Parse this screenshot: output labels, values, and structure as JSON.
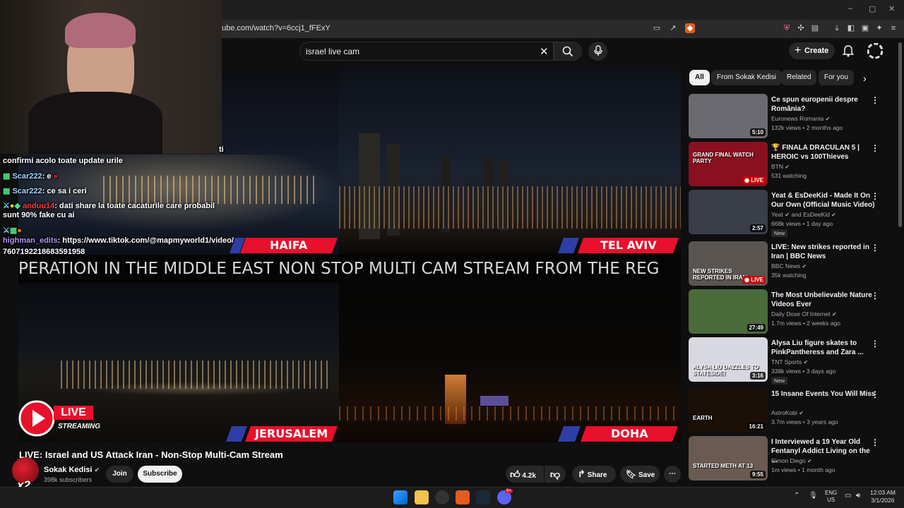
{
  "browser": {
    "url": "ube.com/watch?v=6ccj1_fFExY",
    "window_controls": [
      "–",
      "▢",
      "✕"
    ]
  },
  "search": {
    "query": "israel live cam"
  },
  "header": {
    "create_label": "Create"
  },
  "stream_overlay": {
    "ticker": "PERATION IN THE MIDDLE EAST NON STOP MULTI CAM STREAM FROM THE REG",
    "cameras": [
      "HAIFA",
      "TEL AVIV",
      "JERUSALEM",
      "DOHA"
    ],
    "live_label": "LIVE",
    "streaming_label": "STREAMING"
  },
  "chat": {
    "lines": [
      {
        "user": "",
        "text": "ti",
        "color": "#ffffff"
      },
      {
        "user": "",
        "text": "confirmi acolo toate update urile",
        "color": "#ffffff"
      },
      {
        "user": "Scar222",
        "text": ": e",
        "color": "#9fd4ff"
      },
      {
        "user": "Scar222",
        "text": ": ce sa i ceri",
        "color": "#9fd4ff"
      },
      {
        "user": "anduu14",
        "text": ": dati share la toate cacaturile care probabil",
        "color": "#ff3b3b"
      },
      {
        "user": "",
        "text": "sunt 90% fake cu ai",
        "color": "#ffffff"
      },
      {
        "user": "highman_edits",
        "text": ": https://www.tiktok.com/@mapmyworld1/video/",
        "color": "#b392f0"
      },
      {
        "user": "",
        "text": "7607192218683591958",
        "color": "#ffffff"
      }
    ]
  },
  "video": {
    "title": "LIVE: Israel and US Attack Iran - Non-Stop Multi-Cam Stream",
    "channel": "Sokak Kedisi",
    "subscribers": "398k subscribers",
    "join_label": "Join",
    "subscribe_label": "Subscribe",
    "likes": "4.2k",
    "share_label": "Share",
    "save_label": "Save",
    "overlay_badge": "x2"
  },
  "chips": [
    "All",
    "From Sokak Kedisi",
    "Related",
    "For you"
  ],
  "recommendations": [
    {
      "title": "Ce spun europenii despre România?",
      "channel": "Euronews Romania",
      "meta": "132k views • 2 months ago",
      "duration": "5:10",
      "live": false,
      "new": false,
      "thumb": "#6b6a70"
    },
    {
      "title": "🏆 FINALA DRACULAN 5 | HEROIC vs 100Thieves",
      "channel": "BTN",
      "meta": "531 watching",
      "duration": "",
      "live": true,
      "new": false,
      "thumb": "#8a1020",
      "thumb_text": "GRAND FINAL WATCH PARTY"
    },
    {
      "title": "Yeat & EsDeeKid - Made It On Our Own (Official Music Video)",
      "channel": "Yeat ✔ and EsDeeKid",
      "meta": "668k views • 1 day ago",
      "duration": "2:57",
      "live": false,
      "new": true,
      "thumb": "#3a3e48"
    },
    {
      "title": "LIVE: New strikes reported in Iran | BBC News",
      "channel": "BBC News",
      "meta": "35k watching",
      "duration": "",
      "live": true,
      "new": false,
      "thumb": "#5a5550",
      "thumb_text": "NEW STRIKES REPORTED IN IRAN"
    },
    {
      "title": "The Most Unbelievable Nature Videos Ever",
      "channel": "Daily Dose Of Internet",
      "meta": "1.7m views • 2 weeks ago",
      "duration": "27:49",
      "live": false,
      "new": false,
      "thumb": "#4a6b3a"
    },
    {
      "title": "Alysa Liu figure skates to PinkPantheress and Zara ...",
      "channel": "TNT Sports",
      "meta": "338k views • 3 days ago",
      "duration": "3:16",
      "live": false,
      "new": true,
      "thumb": "#d8d8e0",
      "thumb_text": "ALYSA LIU DAZZLES TO STATESIDE!"
    },
    {
      "title": "15 Insane Events You Will Miss",
      "channel": "AstroKobi",
      "meta": "3.7m views • 3 years ago",
      "duration": "16:21",
      "live": false,
      "new": false,
      "thumb": "#1a1008",
      "thumb_text": "EARTH"
    },
    {
      "title": "I Interviewed a 19 Year Old Fentanyl Addict Living on the ...",
      "channel": "Simon Diego",
      "meta": "1m views • 1 month ago",
      "duration": "9:55",
      "live": false,
      "new": false,
      "thumb": "#6a5a52",
      "thumb_text": "STARTED METH AT 13"
    }
  ],
  "taskbar": {
    "language_top": "ENG",
    "language_bottom": "US",
    "time": "12:03 AM",
    "date": "3/1/2026",
    "discord_badge": "9+"
  },
  "colors": {
    "accent_red": "#e8102a",
    "bg": "#0f0f0f",
    "chip_bg": "#272727"
  }
}
